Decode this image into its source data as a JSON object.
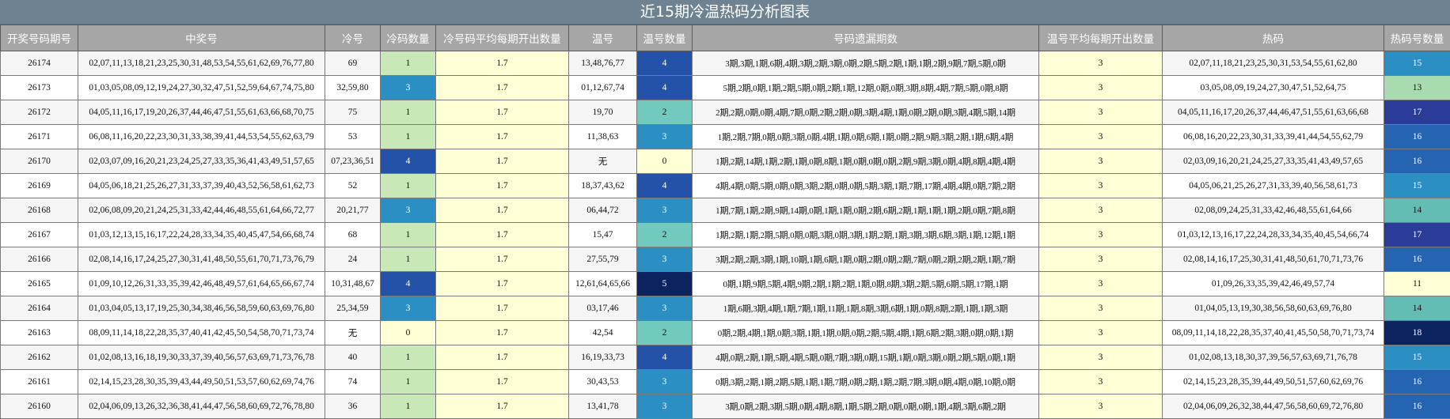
{
  "title": "近15期冷温热码分析图表",
  "headers": [
    "开奖号码期号",
    "中奖号",
    "冷号",
    "冷码数量",
    "冷号码平均每期开出数量",
    "温号",
    "温号数量",
    "号码遗漏期数",
    "温号平均每期开出数量",
    "热码",
    "热码号数量"
  ],
  "colors": {
    "title_bg": "#6e8291",
    "header_bg": "#a6a6a6",
    "yellow": "#ffffd6",
    "scale": {
      "0": "#ffffd6",
      "1": "#c8e8b8",
      "2": "#72c9bd",
      "3": "#2c8fc4",
      "4": "#2352a8",
      "5": "#0b2460"
    }
  },
  "rows": [
    {
      "period": "26174",
      "numbers": "02,07,11,13,18,21,23,25,30,31,48,53,54,55,61,62,69,76,77,80",
      "cold": "69",
      "cold_count": "1",
      "cold_avg": "1.7",
      "warm": "13,48,76,77",
      "warm_count": "4",
      "miss": "3期,3期,1期,6期,4期,3期,2期,3期,0期,2期,5期,2期,1期,1期,2期,9期,7期,5期,0期",
      "warm_avg": "3",
      "hot": "02,07,11,18,21,23,25,30,31,53,54,55,61,62,80",
      "hot_count": "15",
      "hot_color": "#2c8fc4"
    },
    {
      "period": "26173",
      "numbers": "01,03,05,08,09,12,19,24,27,30,32,47,51,52,59,64,67,74,75,80",
      "cold": "32,59,80",
      "cold_count": "3",
      "cold_avg": "1.7",
      "warm": "01,12,67,74",
      "warm_count": "4",
      "miss": "5期,2期,0期,1期,2期,5期,0期,2期,1期,12期,0期,0期,3期,8期,4期,7期,5期,0期,8期",
      "warm_avg": "3",
      "hot": "03,05,08,09,19,24,27,30,47,51,52,64,75",
      "hot_count": "13",
      "hot_color": "#a8dcb0"
    },
    {
      "period": "26172",
      "numbers": "04,05,11,16,17,19,20,26,37,44,46,47,51,55,61,63,66,68,70,75",
      "cold": "75",
      "cold_count": "1",
      "cold_avg": "1.7",
      "warm": "19,70",
      "warm_count": "2",
      "miss": "2期,2期,0期,0期,4期,7期,0期,2期,2期,0期,3期,4期,1期,0期,2期,0期,3期,4期,5期,14期",
      "warm_avg": "3",
      "hot": "04,05,11,16,17,20,26,37,44,46,47,51,55,61,63,66,68",
      "hot_count": "17",
      "hot_color": "#2a3c98"
    },
    {
      "period": "26171",
      "numbers": "06,08,11,16,20,22,23,30,31,33,38,39,41,44,53,54,55,62,63,79",
      "cold": "53",
      "cold_count": "1",
      "cold_avg": "1.7",
      "warm": "11,38,63",
      "warm_count": "3",
      "miss": "1期,2期,7期,0期,0期,3期,0期,4期,1期,0期,6期,1期,0期,2期,9期,3期,2期,1期,6期,4期",
      "warm_avg": "3",
      "hot": "06,08,16,20,22,23,30,31,33,39,41,44,54,55,62,79",
      "hot_count": "16",
      "hot_color": "#2464b0"
    },
    {
      "period": "26170",
      "numbers": "02,03,07,09,16,20,21,23,24,25,27,33,35,36,41,43,49,51,57,65",
      "cold": "07,23,36,51",
      "cold_count": "4",
      "cold_avg": "1.7",
      "warm": "无",
      "warm_count": "0",
      "miss": "1期,2期,14期,1期,2期,1期,0期,8期,1期,0期,0期,0期,2期,9期,3期,0期,4期,8期,4期,4期",
      "warm_avg": "3",
      "hot": "02,03,09,16,20,21,24,25,27,33,35,41,43,49,57,65",
      "hot_count": "16",
      "hot_color": "#2464b0"
    },
    {
      "period": "26169",
      "numbers": "04,05,06,18,21,25,26,27,31,33,37,39,40,43,52,56,58,61,62,73",
      "cold": "52",
      "cold_count": "1",
      "cold_avg": "1.7",
      "warm": "18,37,43,62",
      "warm_count": "4",
      "miss": "4期,4期,0期,5期,0期,0期,3期,2期,0期,0期,5期,3期,1期,7期,17期,4期,4期,0期,7期,2期",
      "warm_avg": "3",
      "hot": "04,05,06,21,25,26,27,31,33,39,40,56,58,61,73",
      "hot_count": "15",
      "hot_color": "#2c8fc4"
    },
    {
      "period": "26168",
      "numbers": "02,06,08,09,20,21,24,25,31,33,42,44,46,48,55,61,64,66,72,77",
      "cold": "20,21,77",
      "cold_count": "3",
      "cold_avg": "1.7",
      "warm": "06,44,72",
      "warm_count": "3",
      "miss": "1期,7期,1期,2期,9期,14期,0期,1期,1期,0期,2期,6期,2期,1期,1期,1期,2期,0期,7期,8期",
      "warm_avg": "3",
      "hot": "02,08,09,24,25,31,33,42,46,48,55,61,64,66",
      "hot_count": "14",
      "hot_color": "#63bdb4"
    },
    {
      "period": "26167",
      "numbers": "01,03,12,13,15,16,17,22,24,28,33,34,35,40,45,47,54,66,68,74",
      "cold": "68",
      "cold_count": "1",
      "cold_avg": "1.7",
      "warm": "15,47",
      "warm_count": "2",
      "miss": "1期,2期,1期,2期,5期,0期,0期,3期,0期,3期,1期,2期,1期,3期,3期,6期,3期,1期,12期,1期",
      "warm_avg": "3",
      "hot": "01,03,12,13,16,17,22,24,28,33,34,35,40,45,54,66,74",
      "hot_count": "17",
      "hot_color": "#2a3c98"
    },
    {
      "period": "26166",
      "numbers": "02,08,14,16,17,24,25,27,30,31,41,48,50,55,61,70,71,73,76,79",
      "cold": "24",
      "cold_count": "1",
      "cold_avg": "1.7",
      "warm": "27,55,79",
      "warm_count": "3",
      "miss": "3期,2期,2期,3期,1期,10期,1期,6期,1期,0期,2期,0期,2期,7期,0期,2期,2期,2期,1期,7期",
      "warm_avg": "3",
      "hot": "02,08,14,16,17,25,30,31,41,48,50,61,70,71,73,76",
      "hot_count": "16",
      "hot_color": "#2464b0"
    },
    {
      "period": "26165",
      "numbers": "01,09,10,12,26,31,33,35,39,42,46,48,49,57,61,64,65,66,67,74",
      "cold": "10,31,48,67",
      "cold_count": "4",
      "cold_avg": "1.7",
      "warm": "12,61,64,65,66",
      "warm_count": "5",
      "miss": "0期,1期,9期,5期,4期,9期,2期,1期,2期,1期,0期,8期,3期,2期,5期,6期,5期,17期,1期",
      "warm_avg": "3",
      "hot": "01,09,26,33,35,39,42,46,49,57,74",
      "hot_count": "11",
      "hot_color": "#ffffd6"
    },
    {
      "period": "26164",
      "numbers": "01,03,04,05,13,17,19,25,30,34,38,46,56,58,59,60,63,69,76,80",
      "cold": "25,34,59",
      "cold_count": "3",
      "cold_avg": "1.7",
      "warm": "03,17,46",
      "warm_count": "3",
      "miss": "1期,6期,3期,4期,1期,7期,1期,11期,1期,8期,3期,6期,1期,0期,8期,2期,1期,1期,3期",
      "warm_avg": "3",
      "hot": "01,04,05,13,19,30,38,56,58,60,63,69,76,80",
      "hot_count": "14",
      "hot_color": "#63bdb4"
    },
    {
      "period": "26163",
      "numbers": "08,09,11,14,18,22,28,35,37,40,41,42,45,50,54,58,70,71,73,74",
      "cold": "无",
      "cold_count": "0",
      "cold_avg": "1.7",
      "warm": "42,54",
      "warm_count": "2",
      "miss": "0期,2期,4期,1期,0期,3期,1期,1期,0期,0期,2期,5期,4期,1期,6期,2期,3期,0期,0期,1期",
      "warm_avg": "3",
      "hot": "08,09,11,14,18,22,28,35,37,40,41,45,50,58,70,71,73,74",
      "hot_count": "18",
      "hot_color": "#0b2460"
    },
    {
      "period": "26162",
      "numbers": "01,02,08,13,16,18,19,30,33,37,39,40,56,57,63,69,71,73,76,78",
      "cold": "40",
      "cold_count": "1",
      "cold_avg": "1.7",
      "warm": "16,19,33,73",
      "warm_count": "4",
      "miss": "4期,0期,2期,1期,5期,4期,5期,0期,7期,3期,0期,15期,1期,0期,3期,0期,2期,5期,0期,1期",
      "warm_avg": "3",
      "hot": "01,02,08,13,18,30,37,39,56,57,63,69,71,76,78",
      "hot_count": "15",
      "hot_color": "#2c8fc4"
    },
    {
      "period": "26161",
      "numbers": "02,14,15,23,28,30,35,39,43,44,49,50,51,53,57,60,62,69,74,76",
      "cold": "74",
      "cold_count": "1",
      "cold_avg": "1.7",
      "warm": "30,43,53",
      "warm_count": "3",
      "miss": "0期,3期,2期,1期,2期,5期,1期,1期,7期,0期,2期,1期,2期,7期,3期,0期,4期,0期,10期,0期",
      "warm_avg": "3",
      "hot": "02,14,15,23,28,35,39,44,49,50,51,57,60,62,69,76",
      "hot_count": "16",
      "hot_color": "#2464b0"
    },
    {
      "period": "26160",
      "numbers": "02,04,06,09,13,26,32,36,38,41,44,47,56,58,60,69,72,76,78,80",
      "cold": "36",
      "cold_count": "1",
      "cold_avg": "1.7",
      "warm": "13,41,78",
      "warm_count": "3",
      "miss": "3期,0期,2期,3期,5期,0期,4期,8期,1期,5期,2期,0期,0期,0期,1期,4期,3期,6期,2期",
      "warm_avg": "3",
      "hot": "02,04,06,09,26,32,38,44,47,56,58,60,69,72,76,80",
      "hot_count": "16",
      "hot_color": "#2464b0"
    }
  ]
}
